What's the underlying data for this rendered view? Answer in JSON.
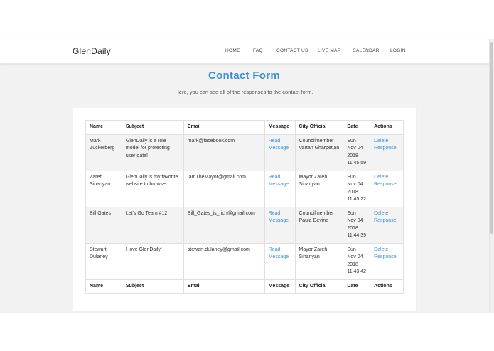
{
  "brand": "GlenDaily",
  "nav": [
    "HOME",
    "FAQ",
    "CONTACT US",
    "LIVE MAP",
    "CALENDAR",
    "LOGIN"
  ],
  "page": {
    "title": "Contact Form",
    "subtitle": "Here, you can see all of the responses to the contact form."
  },
  "table": {
    "headers": [
      "Name",
      "Subject",
      "Email",
      "Message",
      "City Official",
      "Date",
      "Actions"
    ],
    "rows": [
      {
        "name": "Mark Zuckerberg",
        "subject": "GlenDaily is a role model for protecting user data!",
        "email": "mark@facebook.com",
        "message": "Read Message",
        "official": "Councilmember Vartan Gharpetian",
        "date": "Sun Nov 04 2018 11:45:59",
        "action": "Delete Response"
      },
      {
        "name": "Zareh Sinanyan",
        "subject": "GlenDaily is my favorite website to browse",
        "email": "IamTheMayor@gmail.com",
        "message": "Read Message",
        "official": "Mayor Zareh Sinanyan",
        "date": "Sun Nov 04 2018 11:45:22",
        "action": "Delete Response"
      },
      {
        "name": "Bill Gates",
        "subject": "Let's Go Team #12",
        "email": "Bill_Gates_is_rich@gmail.com",
        "message": "Read Message",
        "official": "Councilmember Paula Devine",
        "date": "Sun Nov 04 2018 11:44:39",
        "action": "Delete Response"
      },
      {
        "name": "Stewart Dulaney",
        "subject": "I love GlenDaily!",
        "email": "stewart.dulaney@gmail.com",
        "message": "Read Message",
        "official": "Mayor Zareh Sinanyan",
        "date": "Sun Nov 04 2018 11:43:42",
        "action": "Delete Response"
      }
    ]
  },
  "colors": {
    "accent": "#3a8fd6",
    "background": "#f2f2f2",
    "row_alt": "#f3f3f3"
  }
}
